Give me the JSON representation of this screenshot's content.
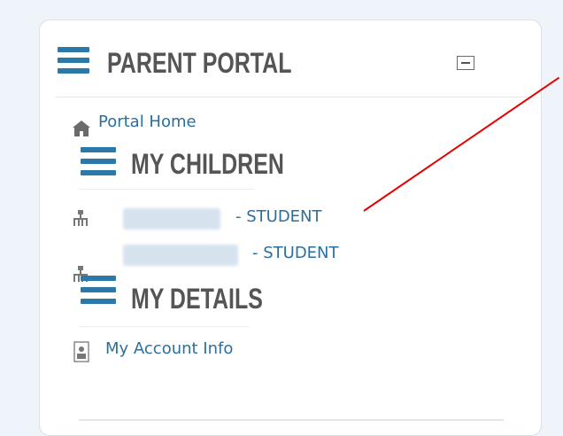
{
  "panel": {
    "title": "PARENT PORTAL"
  },
  "nav": {
    "portal_home": "Portal Home",
    "my_children_heading": "MY CHILDREN",
    "children": [
      {
        "name_redacted": true,
        "role": "- STUDENT"
      },
      {
        "name_redacted": true,
        "role": "- STUDENT"
      }
    ],
    "my_details_heading": "MY DETAILS",
    "account_info": "My Account Info"
  },
  "icons": {
    "menu": "hamburger-icon",
    "collapse": "minus-square-icon",
    "home": "home-icon",
    "child": "hierarchy-icon",
    "account": "id-card-icon"
  },
  "colors": {
    "accent": "#2b79a8",
    "link": "#2a6f9e",
    "annotation": "#e60000"
  }
}
